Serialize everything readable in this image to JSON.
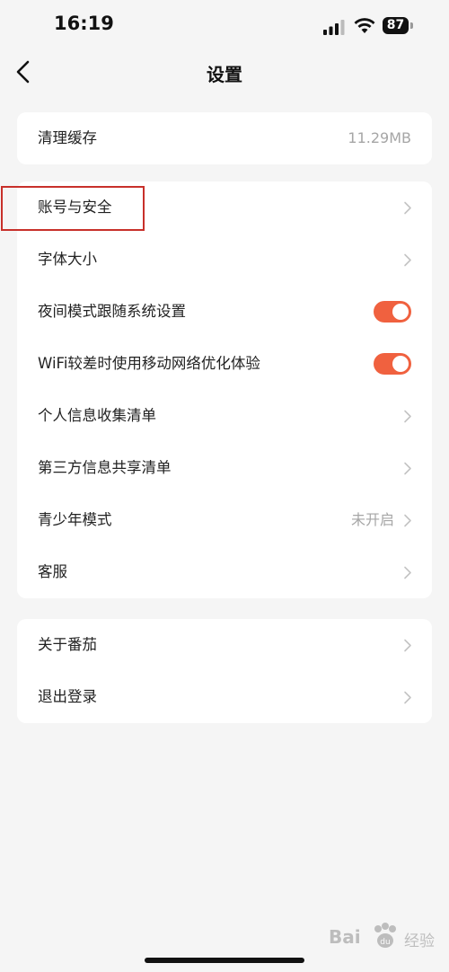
{
  "status_bar": {
    "time": "16:19",
    "battery": "87"
  },
  "nav": {
    "title": "设置"
  },
  "groups": {
    "cache": {
      "label": "清理缓存",
      "value": "11.29MB"
    },
    "main": {
      "account": "账号与安全",
      "font_size": "字体大小",
      "night_mode": {
        "label": "夜间模式跟随系统设置",
        "enabled": true
      },
      "wifi_optimize": {
        "label": "WiFi较差时使用移动网络优化体验",
        "enabled": true
      },
      "personal_info": "个人信息收集清单",
      "third_party": "第三方信息共享清单",
      "youth_mode": {
        "label": "青少年模式",
        "value": "未开启"
      },
      "customer_service": "客服"
    },
    "other": {
      "about": "关于番茄",
      "logout": "退出登录"
    }
  },
  "watermark": {
    "logo": "Bai",
    "text": "经验"
  },
  "colors": {
    "accent": "#f0613f",
    "highlight": "#c8302a",
    "background": "#f5f5f5"
  }
}
